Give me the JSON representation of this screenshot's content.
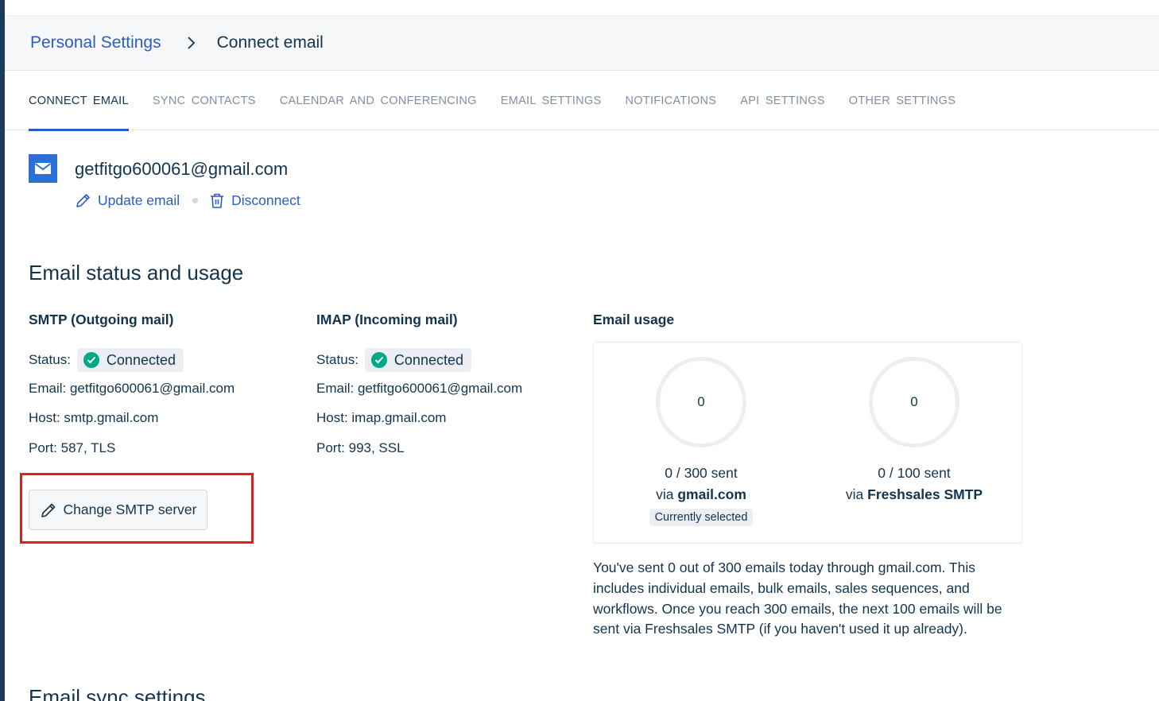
{
  "breadcrumb": {
    "parent": "Personal Settings",
    "current": "Connect email"
  },
  "tabs": [
    {
      "label": "CONNECT  EMAIL",
      "active": true
    },
    {
      "label": "SYNC  CONTACTS",
      "active": false
    },
    {
      "label": "CALENDAR  AND  CONFERENCING",
      "active": false
    },
    {
      "label": "EMAIL  SETTINGS",
      "active": false
    },
    {
      "label": "NOTIFICATIONS",
      "active": false
    },
    {
      "label": "API  SETTINGS",
      "active": false
    },
    {
      "label": "OTHER  SETTINGS",
      "active": false
    }
  ],
  "account": {
    "email": "getfitgo600061@gmail.com",
    "update_label": "Update email",
    "disconnect_label": "Disconnect",
    "icon": "mail-icon"
  },
  "section_title": "Email status and usage",
  "smtp": {
    "title": "SMTP (Outgoing mail)",
    "status_label": "Status:",
    "status_value": "Connected",
    "email": "Email: getfitgo600061@gmail.com",
    "host": "Host: smtp.gmail.com",
    "port": "Port: 587, TLS",
    "change_button": "Change SMTP server"
  },
  "imap": {
    "title": "IMAP (Incoming mail)",
    "status_label": "Status:",
    "status_value": "Connected",
    "email": "Email: getfitgo600061@gmail.com",
    "host": "Host: imap.gmail.com",
    "port": "Port: 993, SSL"
  },
  "usage": {
    "title": "Email usage",
    "gauges": [
      {
        "count": "0",
        "sent": "0 / 300 sent",
        "via_prefix": "via ",
        "via_name": "gmail.com",
        "tag": "Currently selected"
      },
      {
        "count": "0",
        "sent": "0 / 100 sent",
        "via_prefix": "via ",
        "via_name": "Freshsales SMTP",
        "tag": ""
      }
    ],
    "note": "You've sent 0 out of 300 emails today through gmail.com. This includes individual emails, bulk emails, sales sequences, and workflows. Once you reach 300 emails, the next 100 emails will be sent via Freshsales SMTP (if you haven't used it up already)."
  },
  "next_section_title": "Email sync settings",
  "colors": {
    "link": "#2c5cc5",
    "text": "#12344d",
    "success": "#00a886",
    "highlight": "#e02020"
  }
}
